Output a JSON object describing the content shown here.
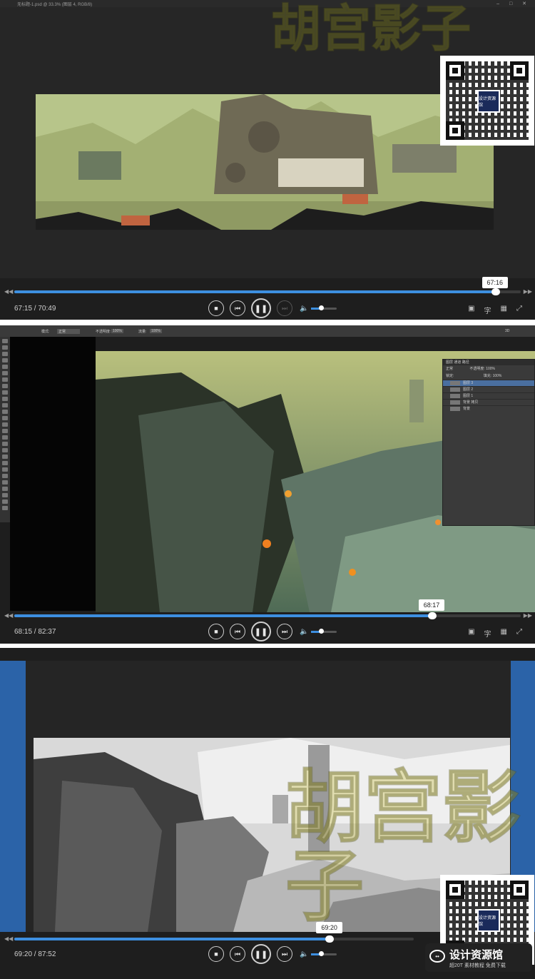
{
  "panel1": {
    "title": "无标题-1.psd @ 33.3% (图层 4, RGB/8)",
    "time_current": "67:15",
    "time_total": "70:49",
    "tooltip": "67:16",
    "progress": 0.95
  },
  "panel2": {
    "mode_label": "模式:",
    "mode_value": "正常",
    "opacity_label": "不透明度:",
    "opacity_value": "100%",
    "flow_label": "流量:",
    "flow_value": "100%",
    "zoom": "3D",
    "layers_tabs": "图层  通道  路径",
    "layer_mode": "正常",
    "layer_opacity_label": "不透明度:",
    "layer_opacity": "100%",
    "lock_label": "锁定:",
    "fill_label": "填充:",
    "fill_value": "100%",
    "layers": [
      "图层 3",
      "图层 2",
      "图层 1",
      "背景 拷贝",
      "背景"
    ],
    "time_current": "68:15",
    "time_total": "82:37",
    "tooltip": "68:17",
    "progress": 0.825
  },
  "panel3": {
    "time_current": "69:20",
    "time_total": "87:52",
    "tooltip": "69:20",
    "progress": 0.79
  },
  "player": {
    "separator": " / ",
    "stop_icon": "■",
    "prev_icon": "⏮",
    "pause_icon": "❚❚",
    "next_icon": "⏭",
    "volume_icon": "🔈",
    "right_icons": [
      "▣",
      "字",
      "▦",
      "⤢"
    ]
  },
  "qr_center_label": "设计资源馆",
  "watermark": "胡宫影子",
  "brand": {
    "name": "设计资源馆",
    "slogan": "超20T 素材教程  免费下载"
  }
}
